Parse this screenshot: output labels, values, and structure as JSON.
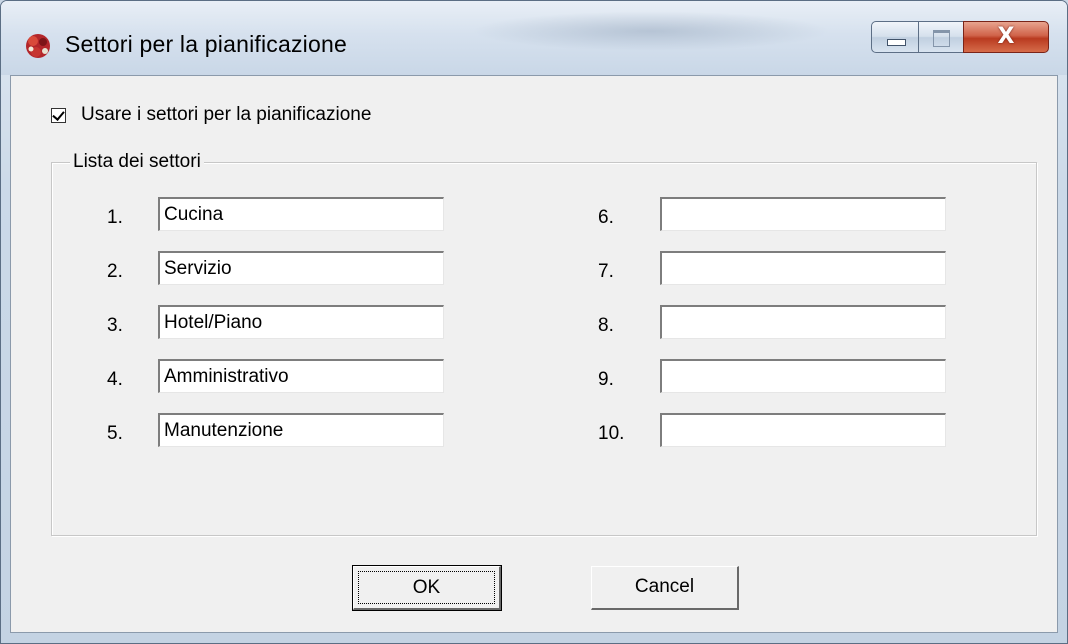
{
  "window": {
    "title": "Settori per la pianificazione",
    "close_glyph": "X"
  },
  "options": {
    "use_sectors_label": "Usare i settori per la pianificazione",
    "use_sectors_checked": true
  },
  "group": {
    "legend": "Lista dei settori",
    "left_column": [
      {
        "number": "1.",
        "value": "Cucina"
      },
      {
        "number": "2.",
        "value": "Servizio"
      },
      {
        "number": "3.",
        "value": "Hotel/Piano"
      },
      {
        "number": "4.",
        "value": "Amministrativo"
      },
      {
        "number": "5.",
        "value": "Manutenzione"
      }
    ],
    "right_column": [
      {
        "number": "6.",
        "value": ""
      },
      {
        "number": "7.",
        "value": ""
      },
      {
        "number": "8.",
        "value": ""
      },
      {
        "number": "9.",
        "value": ""
      },
      {
        "number": "10.",
        "value": ""
      }
    ]
  },
  "buttons": {
    "ok_label": "OK",
    "cancel_label": "Cancel"
  }
}
